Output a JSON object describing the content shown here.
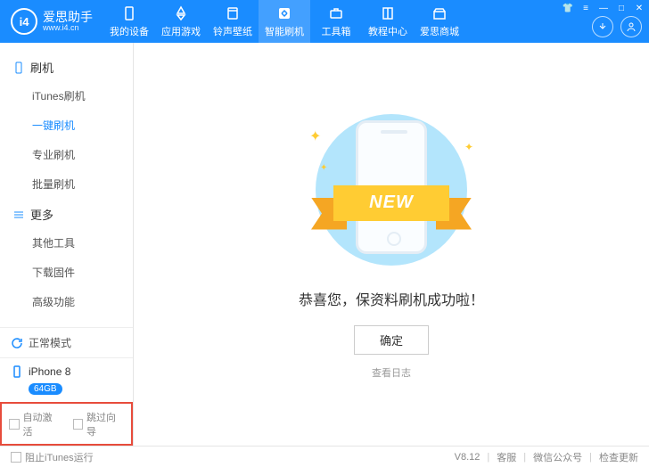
{
  "app": {
    "name": "爱思助手",
    "url": "www.i4.cn",
    "logo_text": "i4"
  },
  "nav": [
    {
      "label": "我的设备",
      "icon": "device"
    },
    {
      "label": "应用游戏",
      "icon": "apps"
    },
    {
      "label": "铃声壁纸",
      "icon": "music"
    },
    {
      "label": "智能刷机",
      "icon": "flash",
      "active": true
    },
    {
      "label": "工具箱",
      "icon": "toolbox"
    },
    {
      "label": "教程中心",
      "icon": "book"
    },
    {
      "label": "爱思商城",
      "icon": "shop"
    }
  ],
  "sidebar": {
    "groups": [
      {
        "title": "刷机",
        "items": [
          "iTunes刷机",
          "一键刷机",
          "专业刷机",
          "批量刷机"
        ],
        "activeIndex": 1
      },
      {
        "title": "更多",
        "items": [
          "其他工具",
          "下载固件",
          "高级功能"
        ]
      }
    ],
    "status": "正常模式",
    "device": {
      "name": "iPhone 8",
      "capacity": "64GB"
    },
    "checks": [
      {
        "label": "自动激活",
        "checked": false
      },
      {
        "label": "跳过向导",
        "checked": false
      }
    ]
  },
  "content": {
    "ribbon": "NEW",
    "message": "恭喜您，保资料刷机成功啦！",
    "ok": "确定",
    "log": "查看日志"
  },
  "footer": {
    "block_itunes": "阻止iTunes运行",
    "version": "V8.12",
    "links": [
      "客服",
      "微信公众号",
      "检查更新"
    ]
  }
}
